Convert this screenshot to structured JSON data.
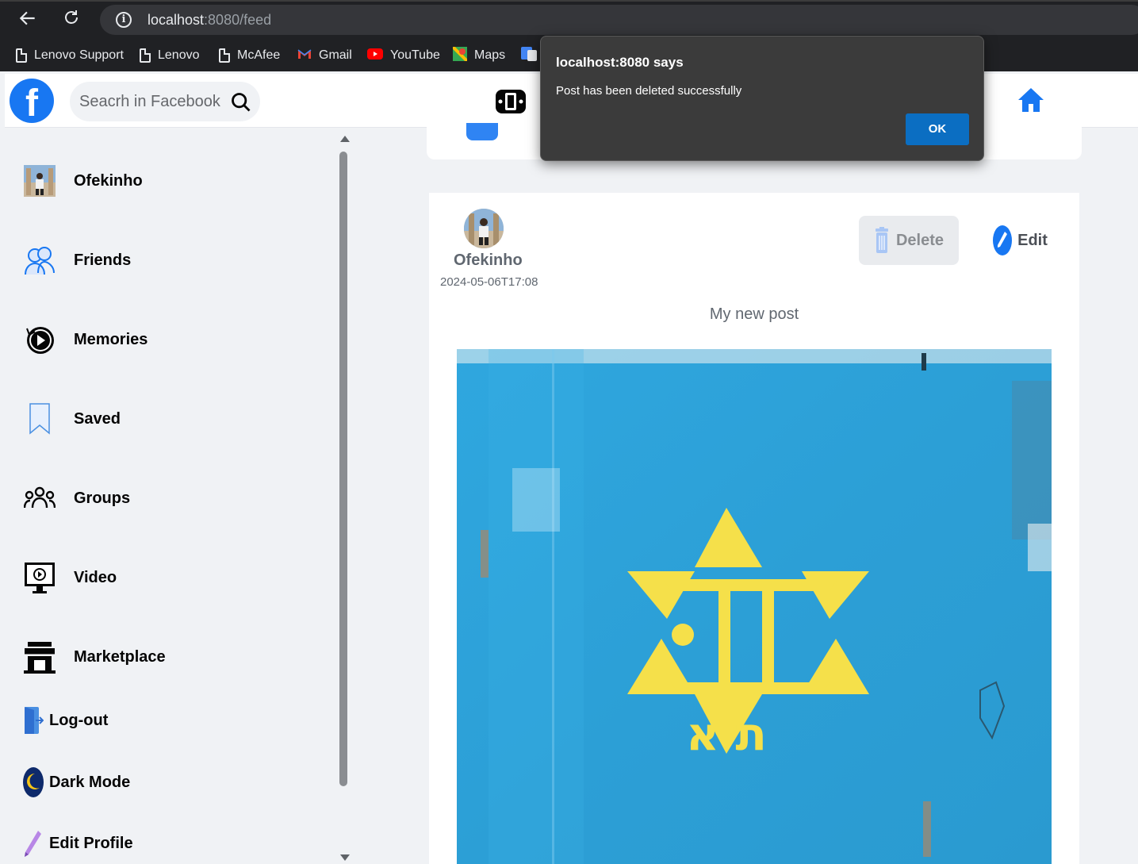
{
  "browser": {
    "url_host": "localhost",
    "url_rest": ":8080/feed",
    "bookmarks": [
      {
        "label": "Lenovo Support",
        "icon": "document-icon"
      },
      {
        "label": "Lenovo",
        "icon": "document-icon"
      },
      {
        "label": "McAfee",
        "icon": "document-icon"
      },
      {
        "label": "Gmail",
        "icon": "gmail-icon"
      },
      {
        "label": "YouTube",
        "icon": "youtube-icon"
      },
      {
        "label": "Maps",
        "icon": "maps-icon"
      }
    ]
  },
  "header": {
    "logo": "f",
    "search_placeholder": "Seacrh in Facebook"
  },
  "sidebar": {
    "items": [
      {
        "label": "Ofekinho",
        "icon": "profile-avatar"
      },
      {
        "label": "Friends",
        "icon": "friends-icon"
      },
      {
        "label": "Memories",
        "icon": "memories-icon"
      },
      {
        "label": "Saved",
        "icon": "bookmark-icon"
      },
      {
        "label": "Groups",
        "icon": "groups-icon"
      },
      {
        "label": "Video",
        "icon": "video-icon"
      },
      {
        "label": "Marketplace",
        "icon": "marketplace-icon"
      },
      {
        "label": "Log-out",
        "icon": "logout-icon"
      },
      {
        "label": "Dark Mode",
        "icon": "moon-icon"
      },
      {
        "label": "Edit Profile",
        "icon": "pencil-icon"
      }
    ]
  },
  "post": {
    "author": "Ofekinho",
    "date": "2024-05-06T17:08",
    "text": "My new post",
    "delete_label": "Delete",
    "edit_label": "Edit",
    "image_letters": "ת א"
  },
  "dialog": {
    "title": "localhost:8080 says",
    "message": "Post has been deleted successfully",
    "ok_label": "OK"
  },
  "colors": {
    "facebook_blue": "#1877f2",
    "dialog_bg": "#3b3b3b",
    "ok_button": "#0b6ec2"
  }
}
